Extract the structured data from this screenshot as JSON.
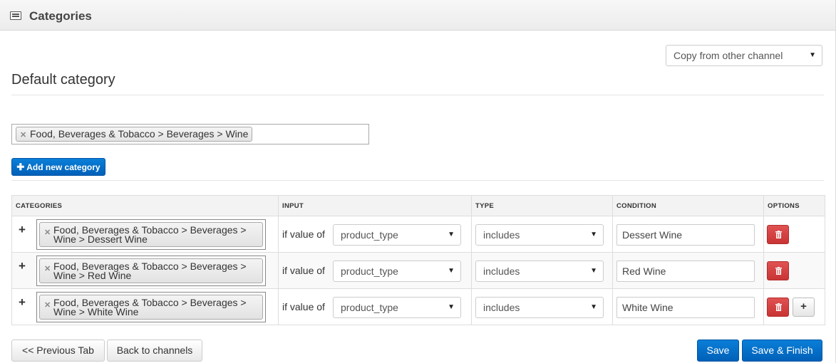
{
  "panel": {
    "title": "Categories",
    "icon": "list-icon"
  },
  "copy_select": {
    "value": "Copy from other channel"
  },
  "default_category": {
    "heading": "Default category",
    "selected": "Food, Beverages & Tobacco > Beverages > Wine"
  },
  "add_button": {
    "label": "Add new category"
  },
  "table": {
    "headers": [
      "CATEGORIES",
      "INPUT",
      "TYPE",
      "CONDITION",
      "OPTIONS"
    ],
    "rows": [
      {
        "category_line1": "Food, Beverages & Tobacco > Beverages >",
        "category_line2": "Wine > Dessert Wine",
        "input_label": "if value of",
        "input_field": "product_type",
        "type": "includes",
        "condition": "Dessert Wine"
      },
      {
        "category_line1": "Food, Beverages & Tobacco > Beverages >",
        "category_line2": "Wine > Red Wine",
        "input_label": "if value of",
        "input_field": "product_type",
        "type": "includes",
        "condition": "Red Wine"
      },
      {
        "category_line1": "Food, Beverages & Tobacco > Beverages >",
        "category_line2": "Wine > White Wine",
        "input_label": "if value of",
        "input_field": "product_type",
        "type": "includes",
        "condition": "White Wine"
      }
    ]
  },
  "footer": {
    "previous": "<< Previous Tab",
    "back": "Back to channels",
    "save": "Save",
    "save_finish": "Save & Finish"
  },
  "colors": {
    "primary": "#0a6fcb",
    "danger": "#d03f3f"
  }
}
